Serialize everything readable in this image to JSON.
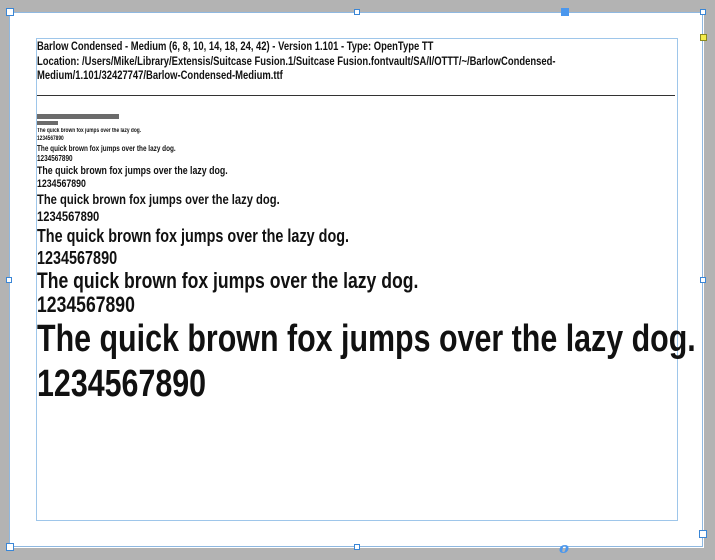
{
  "header": {
    "line1": "Barlow Condensed - Medium (6, 8, 10, 14, 18, 24, 42) - Version 1.101 - Type: OpenType TT",
    "location": "Location: /Users/Mike/Library/Extensis/Suitcase Fusion.1/Suitcase Fusion.fontvault/SA/I/OTTT/~/BarlowCondensed-Medium/1.101/32427747/Barlow-Condensed-Medium.ttf"
  },
  "samples": [
    {
      "size": 6,
      "pangram": "The quick brown fox jumps over the lazy dog.",
      "digits": "1234567890"
    },
    {
      "size": 8,
      "pangram": "The quick brown fox jumps over the lazy dog.",
      "digits": "1234567890"
    },
    {
      "size": 10,
      "pangram": "The quick brown fox jumps over the lazy dog.",
      "digits": "1234567890"
    },
    {
      "size": 14,
      "pangram": "The quick brown fox jumps over the lazy dog.",
      "digits": "1234567890"
    },
    {
      "size": 18,
      "pangram": "The quick brown fox jumps over the lazy dog.",
      "digits": "1234567890"
    },
    {
      "size": 24,
      "pangram": "The quick brown fox jumps over the lazy dog.",
      "digits": "1234567890"
    },
    {
      "size": 42,
      "pangram": "The quick brown fox jumps over the lazy dog.",
      "digits": "1234567890"
    }
  ],
  "overflow_marker": "o",
  "colors": {
    "pasteboard": "#b3b3b3",
    "page": "#ffffff",
    "selection": "#3a86d6",
    "margin_guide": "#9ec6ea"
  }
}
